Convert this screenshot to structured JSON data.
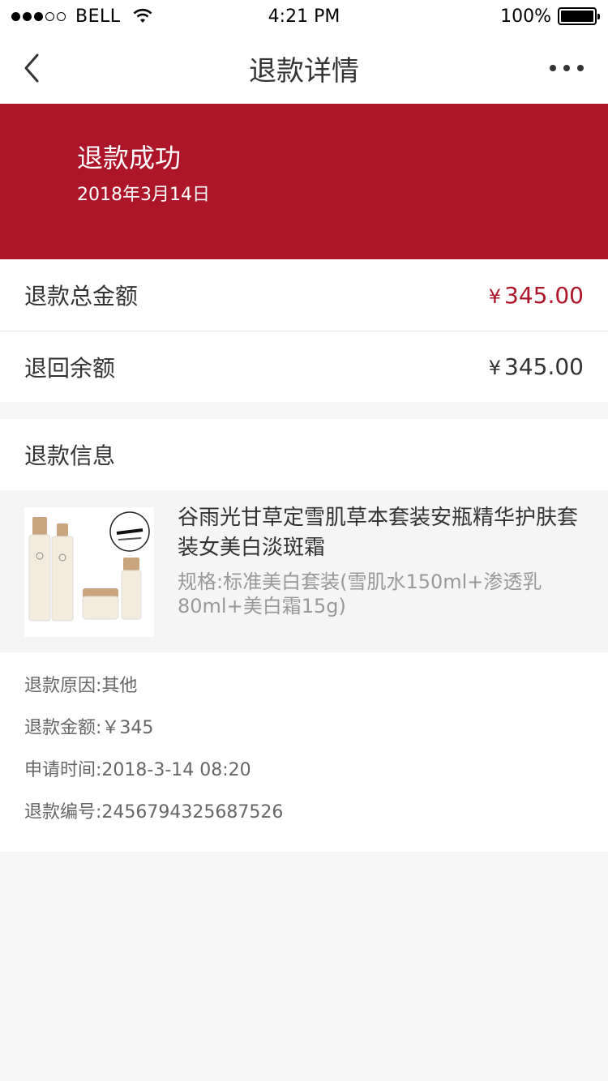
{
  "status_bar": {
    "carrier": "BELL",
    "time": "4:21 PM",
    "battery": "100%",
    "signal_bars_filled": 3,
    "signal_bars_total": 5
  },
  "nav": {
    "title": "退款详情"
  },
  "banner": {
    "status": "退款成功",
    "date": "2018年3月14日",
    "color": "#ad1629"
  },
  "amounts": {
    "total_label": "退款总金额",
    "total_yen": "¥",
    "total_value": "345.00",
    "returned_label": "退回余额",
    "returned_yen": "¥",
    "returned_value": "345.00"
  },
  "refund_info": {
    "header": "退款信息",
    "product": {
      "title": "谷雨光甘草定雪肌草本套装安瓶精华护肤套装女美白淡斑霜",
      "spec": "规格:标准美白套装(雪肌水150ml+渗透乳80ml+美白霜15g)",
      "image_icon": "product-image"
    },
    "details": [
      "退款原因:其他",
      "退款金额:￥345",
      "申请时间:2018-3-14  08:20",
      "退款编号:2456794325687526"
    ]
  }
}
